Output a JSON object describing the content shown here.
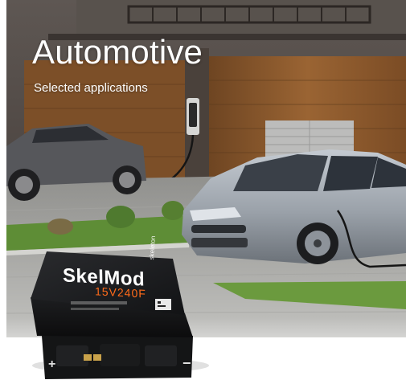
{
  "hero": {
    "title": "Automotive",
    "subtitle": "Selected applications"
  },
  "product": {
    "brand": "SkelMod",
    "model": "15V240F",
    "vendor": "skeleton"
  },
  "colors": {
    "accent_orange": "#ff6b1a",
    "title_white": "#ffffff",
    "module_body": "#1b1c1e",
    "car_silver": "#a7adb4",
    "suv_gray": "#58595d",
    "house_wood": "#8a5a2c",
    "lawn_green": "#5f8f3a",
    "pavement": "#a9a9a6"
  }
}
